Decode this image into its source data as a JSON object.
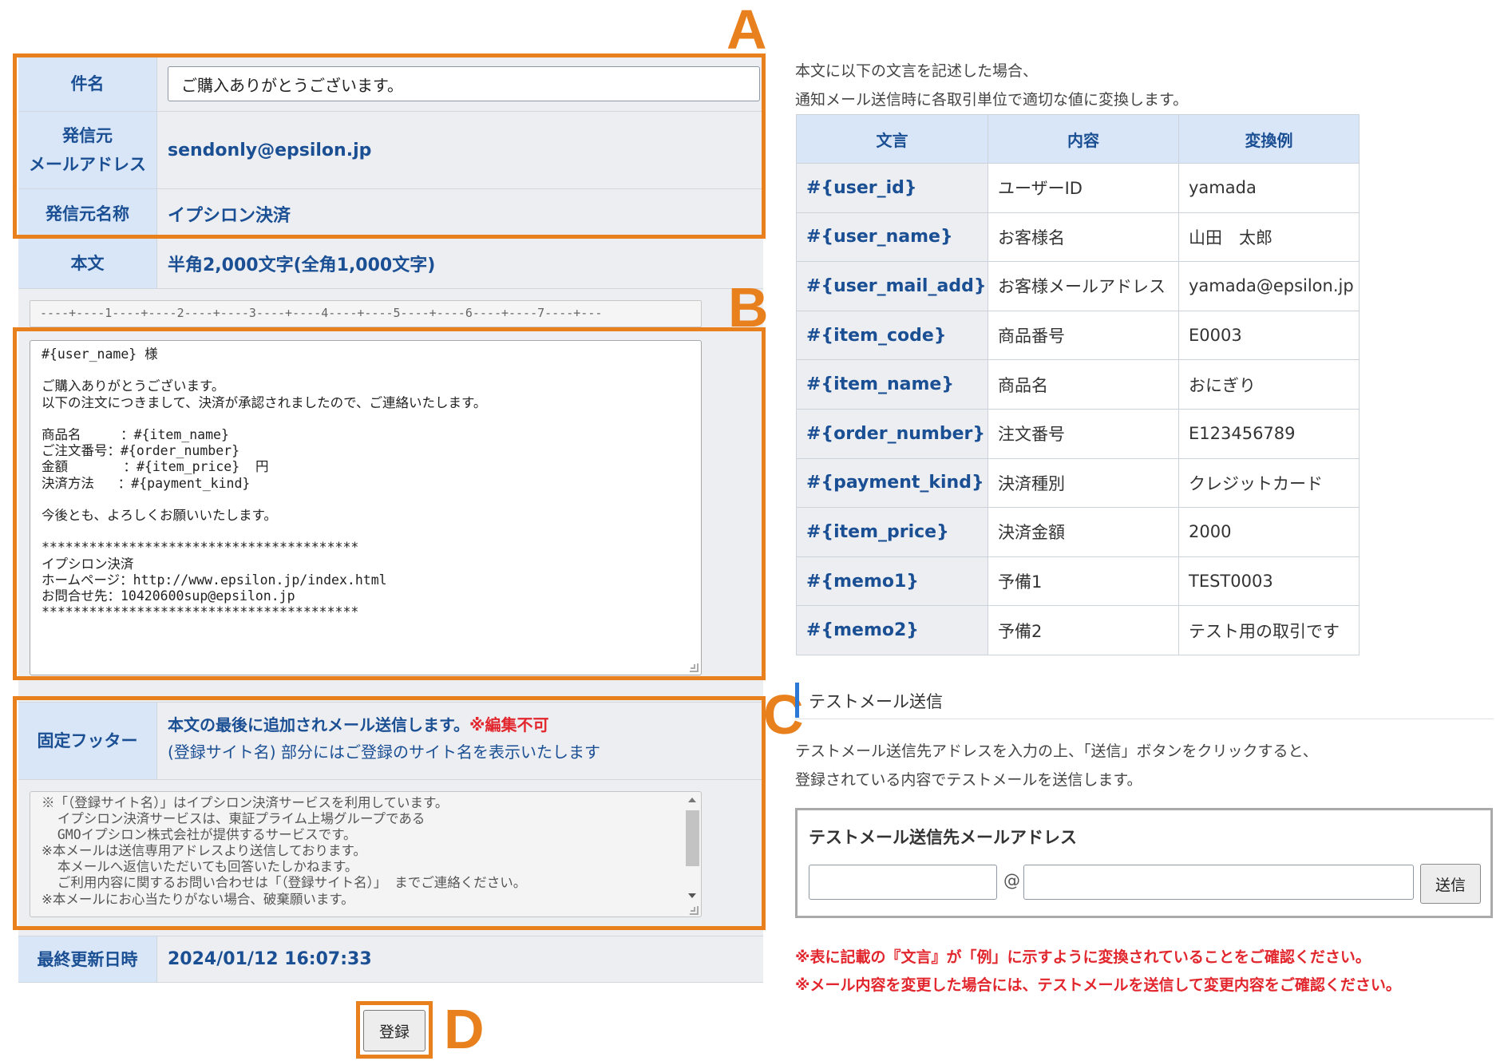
{
  "form": {
    "subject_label": "件名",
    "subject_value": "ご購入ありがとうございます。",
    "from_address_label_line1": "発信元",
    "from_address_label_line2": "メールアドレス",
    "from_address_value": "sendonly@epsilon.jp",
    "from_name_label": "発信元名称",
    "from_name_value": "イプシロン決済",
    "body_label": "本文",
    "body_limit": "半角2,000文字(全角1,000文字)",
    "ruler": "----+----1----+----2----+----3----+----4----+----5----+----6----+----7----+---",
    "body_text": "#{user_name} 様\n\nご購入ありがとうございます。\n以下の注文につきまして、決済が承認されましたので、ご連絡いたします。\n\n商品名     ：#{item_name}\nご注文番号：#{order_number}\n金額       ：#{item_price}  円\n決済方法   ：#{payment_kind}\n\n今後とも、よろしくお願いいたします。\n\n****************************************\nイプシロン決済\nホームページ：http://www.epsilon.jp/index.html\nお問合せ先：10420600sup@epsilon.jp\n****************************************",
    "footer_label": "固定フッター",
    "footer_note_main": "本文の最後に追加されメール送信します。",
    "footer_note_locked": "※編集不可",
    "footer_note_sub": "(登録サイト名) 部分にはご登録のサイト名を表示いたします",
    "footer_text": "※「（登録サイト名）」はイプシロン決済サービスを利用しています。\n  イプシロン決済サービスは、東証プライム上場グループである\n  GMOイプシロン株式会社が提供するサービスです。\n※本メールは送信専用アドレスより送信しております。\n  本メールへ返信いただいても回答いたしかねます。\n  ご利用内容に関するお問い合わせは「（登録サイト名）」 までご連絡ください。\n※本メールにお心当たりがない場合、破棄願います。",
    "updated_label": "最終更新日時",
    "updated_value": "2024/01/12 16:07:33",
    "register_label": "登録"
  },
  "annotations": {
    "a": "A",
    "b": "B",
    "c": "C",
    "d": "D",
    "color": "#e8801e"
  },
  "right": {
    "intro_line1": "本文に以下の文言を記述した場合、",
    "intro_line2": "通知メール送信時に各取引単位で適切な値に変換します。",
    "table_headers": [
      "文言",
      "内容",
      "変換例"
    ],
    "table_rows": [
      [
        "#{user_id}",
        "ユーザーID",
        "yamada"
      ],
      [
        "#{user_name}",
        "お客様名",
        "山田　太郎"
      ],
      [
        "#{user_mail_add}",
        "お客様メールアドレス",
        "yamada@epsilon.jp"
      ],
      [
        "#{item_code}",
        "商品番号",
        "E0003"
      ],
      [
        "#{item_name}",
        "商品名",
        "おにぎり"
      ],
      [
        "#{order_number}",
        "注文番号",
        "E123456789"
      ],
      [
        "#{payment_kind}",
        "決済種別",
        "クレジットカード"
      ],
      [
        "#{item_price}",
        "決済金額",
        "2000"
      ],
      [
        "#{memo1}",
        "予備1",
        "TEST0003"
      ],
      [
        "#{memo2}",
        "予備2",
        "テスト用の取引です"
      ]
    ],
    "test_heading": "テストメール送信",
    "test_desc_line1": "テストメール送信先アドレスを入力の上、「送信」ボタンをクリックすると、",
    "test_desc_line2": "登録されている内容でテストメールを送信します。",
    "test_box_title": "テストメール送信先メールアドレス",
    "at_sign": "@",
    "send_label": "送信",
    "note1": "※表に記載の『文言』が「例」に示すように変換されていることをご確認ください。",
    "note2": "※メール内容を変更した場合には、テストメールを送信して変更内容をご確認ください。"
  },
  "colors": {
    "accent": "#1b4f94",
    "label_bg": "#d9e6f7",
    "alert": "#e2262d",
    "heading_bar": "#2b78d6"
  }
}
